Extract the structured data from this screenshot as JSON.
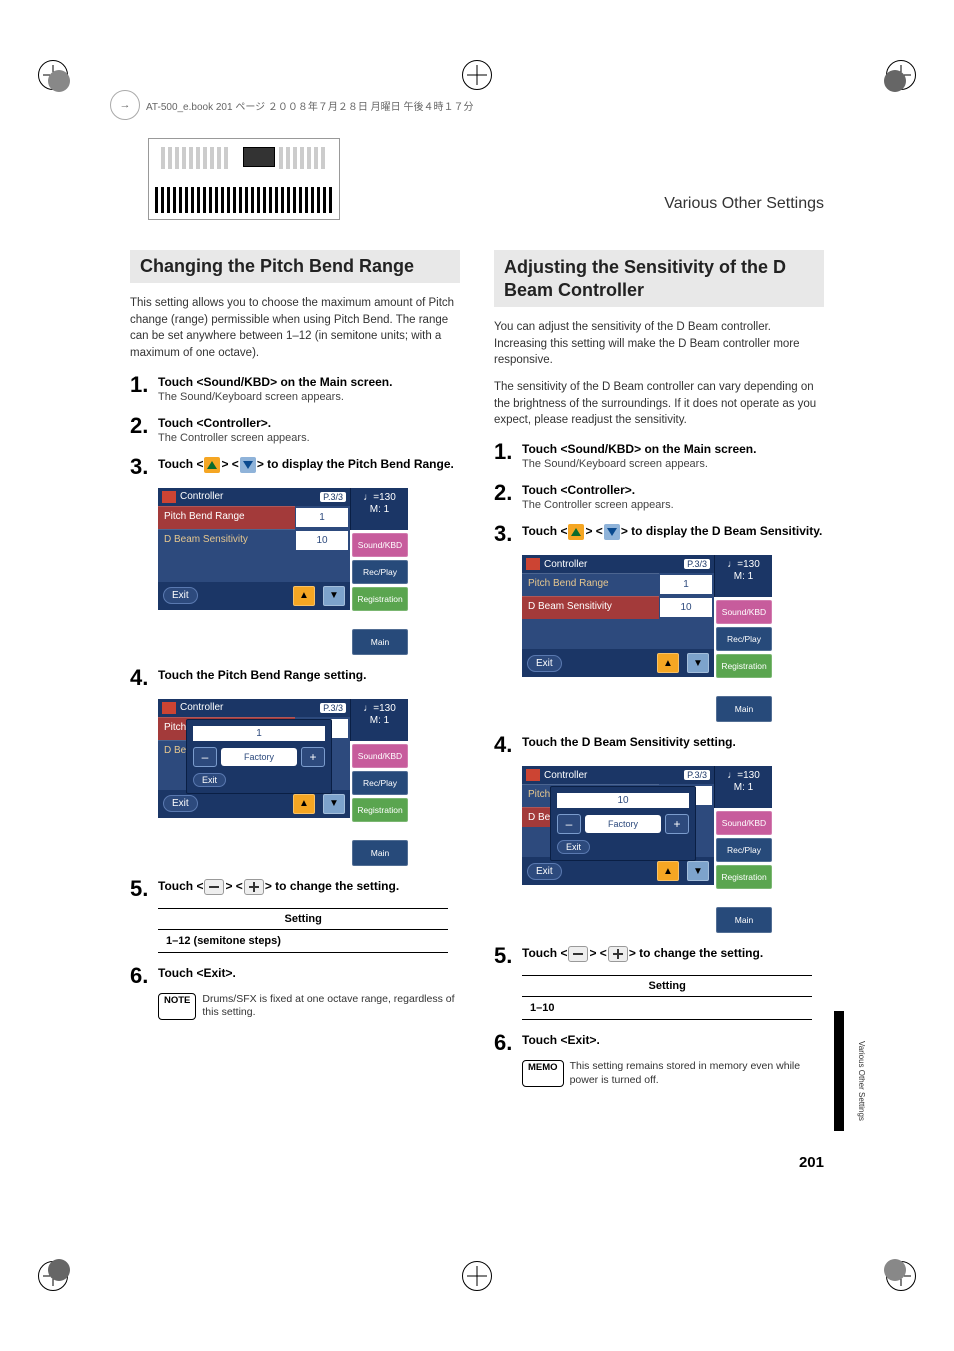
{
  "meta": {
    "book_line": "AT-500_e.book 201 ページ ２００８年７月２８日 月曜日 午後４時１７分",
    "header_title": "Various Other Settings",
    "page_number": "201",
    "side_tab_text": "Various Other Settings"
  },
  "left": {
    "section_title": "Changing the Pitch Bend Range",
    "intro": "This setting allows you to choose the maximum amount of Pitch change (range) permissible when using Pitch Bend. The range can be set anywhere between 1–12 (in semitone units; with a maximum of one octave).",
    "steps": {
      "s1": {
        "num": "1.",
        "main": "Touch <Sound/KBD> on the Main screen.",
        "sub": "The Sound/Keyboard screen appears."
      },
      "s2": {
        "num": "2.",
        "main": "Touch <Controller>.",
        "sub": "The Controller screen appears."
      },
      "s3": {
        "num": "3.",
        "main_pre": "Touch <",
        "main_mid": "> <",
        "main_post": "> to display the Pitch Bend Range."
      },
      "s4": {
        "num": "4.",
        "main": "Touch the Pitch Bend Range setting."
      },
      "s5": {
        "num": "5.",
        "main_pre": "Touch <",
        "main_mid": "> <",
        "main_post": "> to change the setting."
      },
      "s6": {
        "num": "6.",
        "main": "Touch <Exit>."
      }
    },
    "setting_header": "Setting",
    "setting_value": "1–12 (semitone steps)",
    "note_label": "NOTE",
    "note_text": "Drums/SFX is fixed at one octave range, regardless of this setting."
  },
  "right": {
    "section_title": "Adjusting the Sensitivity of the D Beam Controller",
    "intro1": "You can adjust the sensitivity of the D Beam controller. Increasing this setting will make the D Beam controller more responsive.",
    "intro2": "The sensitivity of the D Beam controller can vary depending on the brightness of the surroundings. If it does not operate as you expect, please readjust the sensitivity.",
    "steps": {
      "s1": {
        "num": "1.",
        "main": "Touch <Sound/KBD> on the Main screen.",
        "sub": "The Sound/Keyboard screen appears."
      },
      "s2": {
        "num": "2.",
        "main": "Touch <Controller>.",
        "sub": "The Controller screen appears."
      },
      "s3": {
        "num": "3.",
        "main_pre": "Touch <",
        "main_mid": "> <",
        "main_post": "> to display the D Beam Sensitivity."
      },
      "s4": {
        "num": "4.",
        "main": "Touch the D Beam Sensitivity setting."
      },
      "s5": {
        "num": "5.",
        "main_pre": "Touch <",
        "main_mid": "> <",
        "main_post": "> to change the setting."
      },
      "s6": {
        "num": "6.",
        "main": "Touch <Exit>."
      }
    },
    "setting_header": "Setting",
    "setting_value": "1–10",
    "memo_label": "MEMO",
    "memo_text": "This setting remains stored in memory even while power is turned off."
  },
  "screens": {
    "title": "Controller",
    "page_indicator": "P.3/3",
    "tempo": "♩=130",
    "measure": "M: 1",
    "row1_label": "Pitch Bend Range",
    "row2_label": "D Beam Sensitivity",
    "left_pitch_val": "1",
    "left_dbeam_val": "10",
    "popup_left_val": "1",
    "right_pitch_val": "1",
    "right_dbeam_val": "10",
    "popup_right_val": "10",
    "exit": "Exit",
    "factory": "Factory",
    "side": {
      "sound": "Sound/KBD",
      "rec": "Rec/Play",
      "reg": "Registration",
      "main": "Main"
    }
  }
}
